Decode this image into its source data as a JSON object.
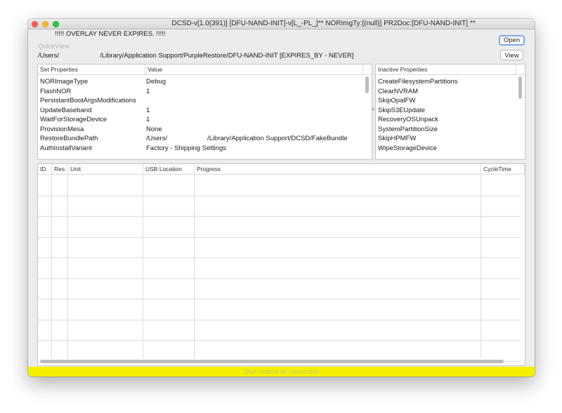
{
  "window": {
    "title": "DCSD-v[1.0(391)] [DFU-NAND-INIT]-v[L_-PL_]** NORImgTy:[(null)] PR2Doc:[DFU-NAND-INIT] **"
  },
  "header": {
    "overlay_note": "!!!!! OVERLAY NEVER EXPIRES. !!!!!",
    "quickview_label": "QuickView",
    "path_prefix": "/Users/",
    "path_rest": "/Library/Application Support/PurpleRestore/DFU-NAND-INIT [EXPIRES_BY - NEVER]",
    "open_button": "Open",
    "view_button": "View"
  },
  "set_properties": {
    "col_property": "Set Properties",
    "col_value": "Value",
    "rows": [
      {
        "name": "NORImageType",
        "value": "Debug",
        "value2": ""
      },
      {
        "name": "FlashNOR",
        "value": "1",
        "value2": ""
      },
      {
        "name": "PersistantBootArgsModifications",
        "value": "",
        "value2": ""
      },
      {
        "name": "UpdateBaseband",
        "value": "1",
        "value2": ""
      },
      {
        "name": "WaitForStorageDevice",
        "value": "1",
        "value2": ""
      },
      {
        "name": "ProvisionMesa",
        "value": "None",
        "value2": ""
      },
      {
        "name": "RestoreBundlePath",
        "value": "/Users/",
        "value2": "/Library/Application Support/DCSD/FakeBundle"
      },
      {
        "name": "AuthInstallVariant",
        "value": "Factory - Shipping Settings",
        "value2": ""
      }
    ]
  },
  "inactive_properties": {
    "col_property": "Inactive Properties",
    "rows": [
      "CreateFilesystemPartitions",
      "ClearNVRAM",
      "SkipOpalFW",
      "SkipS3EUpdate",
      "RecoveryOSUnpack",
      "SystemPartitionSize",
      "SkipHPMFW",
      "WipeStorageDevice"
    ]
  },
  "units_table": {
    "columns": [
      "ID",
      "Res",
      "Unit",
      "USB Location",
      "Progress",
      "CycleTime"
    ],
    "rows": []
  },
  "status": {
    "text": "Start restore on connection",
    "color": "#f4f000"
  }
}
